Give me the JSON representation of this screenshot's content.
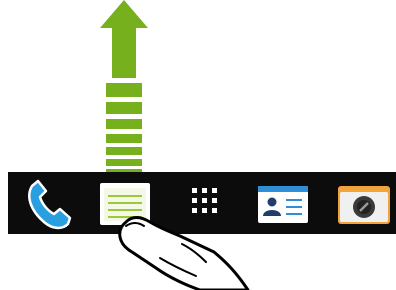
{
  "dock": {
    "background": "#0c0c0c",
    "items": [
      {
        "id": "phone",
        "icon": "phone-icon"
      },
      {
        "id": "notes",
        "icon": "notes-icon",
        "highlighted": true
      },
      {
        "id": "apps",
        "icon": "app-grid-icon"
      },
      {
        "id": "contacts",
        "icon": "contact-card-icon"
      },
      {
        "id": "camera",
        "icon": "camera-icon"
      }
    ]
  },
  "gesture": {
    "type": "swipe-up",
    "hand": "finger-pointer-icon",
    "arrow": "arrow-up-icon"
  },
  "colors": {
    "arrow_green": "#76b01c",
    "phone_blue": "#2a9fe0",
    "notes_green": "#9cc83c",
    "contact_blue": "#2e8fd8",
    "camera_orange": "#f2a43a"
  }
}
